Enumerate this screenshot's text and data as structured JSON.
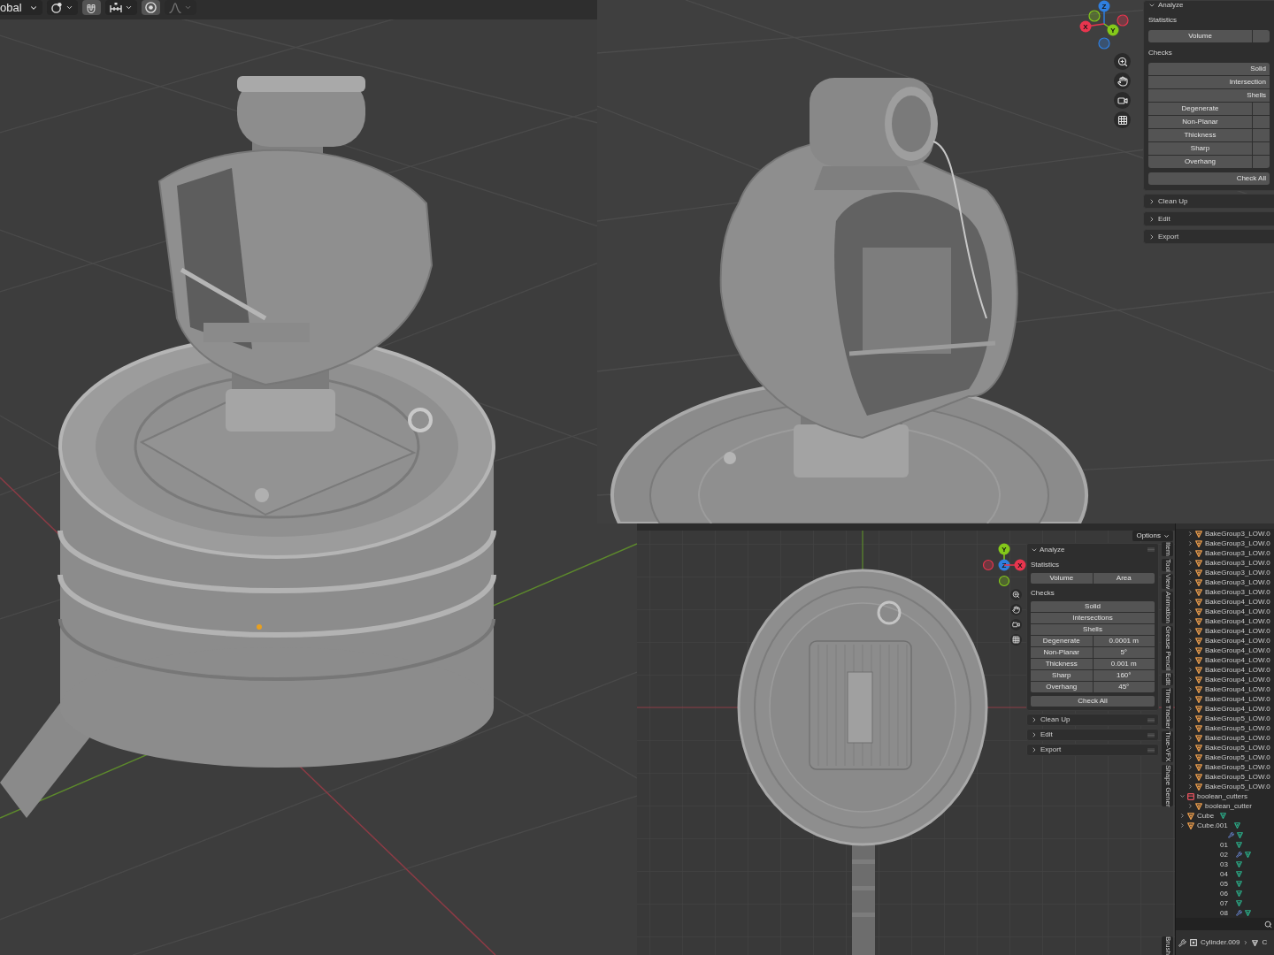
{
  "left_viewport": {
    "header": {
      "orientation": "obal",
      "tools": [
        {
          "kind": "pivot",
          "disabled": false
        },
        {
          "kind": "snap",
          "disabled": false
        },
        {
          "kind": "increment",
          "disabled": false
        },
        {
          "kind": "proportional",
          "disabled": false
        },
        {
          "kind": "falloff",
          "disabled": true
        }
      ]
    }
  },
  "top_right_viewport": {
    "gizmo": [
      {
        "label": "Z",
        "color": "#2f7fe0"
      },
      {
        "label": "X",
        "color": "#e8354e"
      },
      {
        "label": "Y",
        "color": "#84c91a"
      }
    ],
    "nav_buttons": [
      {
        "kind": "zoom"
      },
      {
        "kind": "pan"
      },
      {
        "kind": "camera"
      },
      {
        "kind": "perspective"
      }
    ],
    "panel": {
      "title": "Analyze",
      "expanded": true,
      "groups": [
        {
          "label": "Statistics",
          "rows": [
            {
              "kind": "pair",
              "left": "Volume"
            }
          ]
        },
        {
          "label": "Checks",
          "rows": [
            {
              "kind": "button",
              "text": "Solid"
            },
            {
              "kind": "button",
              "text": "Intersection"
            },
            {
              "kind": "button",
              "text": "Shells"
            },
            {
              "kind": "split",
              "left": "Degenerate"
            },
            {
              "kind": "split",
              "left": "Non-Planar"
            },
            {
              "kind": "split",
              "left": "Thickness"
            },
            {
              "kind": "split",
              "left": "Sharp"
            },
            {
              "kind": "split",
              "left": "Overhang"
            }
          ]
        }
      ],
      "check_all": "Check All",
      "subpanels": [
        {
          "title": "Clean Up",
          "expanded": false
        },
        {
          "title": "Edit",
          "expanded": false
        },
        {
          "title": "Export",
          "expanded": false
        }
      ]
    }
  },
  "bottom_right_viewport": {
    "options": "Options",
    "gizmo": [
      {
        "label": "Y",
        "color": "#84c91a"
      },
      {
        "label": "Z",
        "color": "#2f7fe0"
      },
      {
        "label": "X",
        "color": "#e8354e"
      }
    ],
    "nav_buttons": [
      {
        "kind": "zoom"
      },
      {
        "kind": "pan"
      },
      {
        "kind": "camera"
      },
      {
        "kind": "perspective"
      }
    ],
    "panel": {
      "title": "Analyze",
      "expanded": true,
      "groups": [
        {
          "label": "Statistics",
          "rows": [
            {
              "kind": "pair",
              "left": "Volume",
              "right": "Area"
            }
          ]
        },
        {
          "label": "Checks",
          "rows": [
            {
              "kind": "button",
              "text": "Solid"
            },
            {
              "kind": "button",
              "text": "Intersections"
            },
            {
              "kind": "button",
              "text": "Shells"
            },
            {
              "kind": "split",
              "left": "Degenerate",
              "right": "0.0001 m"
            },
            {
              "kind": "split",
              "left": "Non-Planar",
              "right": "5°"
            },
            {
              "kind": "split",
              "left": "Thickness",
              "right": "0.001 m"
            },
            {
              "kind": "split",
              "left": "Sharp",
              "right": "160°"
            },
            {
              "kind": "split",
              "left": "Overhang",
              "right": "45°"
            }
          ]
        }
      ],
      "check_all": "Check All",
      "subpanels": [
        {
          "title": "Clean Up",
          "expanded": false
        },
        {
          "title": "Edit",
          "expanded": false
        },
        {
          "title": "Export",
          "expanded": false
        }
      ]
    },
    "tabs": [
      "Item",
      "Tool",
      "View",
      "Animation",
      "Grease Pencil",
      "Edit",
      "Time Tracker",
      "True-VFX",
      "Shape Gener",
      "Brush"
    ],
    "outliner": {
      "continued_children": [
        {
          "kind": "object",
          "text": "BakeGroup3_LOW.0",
          "expanded": false
        },
        {
          "kind": "object",
          "text": "BakeGroup3_LOW.0",
          "expanded": false
        },
        {
          "kind": "object",
          "text": "BakeGroup3_LOW.0",
          "expanded": false
        },
        {
          "kind": "object",
          "text": "BakeGroup3_LOW.0",
          "expanded": false
        },
        {
          "kind": "object",
          "text": "BakeGroup3_LOW.0",
          "expanded": false
        },
        {
          "kind": "object",
          "text": "BakeGroup3_LOW.0",
          "expanded": false
        },
        {
          "kind": "object",
          "text": "BakeGroup3_LOW.0",
          "expanded": false
        },
        {
          "kind": "object",
          "text": "BakeGroup4_LOW.0",
          "expanded": false
        },
        {
          "kind": "object",
          "text": "BakeGroup4_LOW.0",
          "expanded": false
        },
        {
          "kind": "object",
          "text": "BakeGroup4_LOW.0",
          "expanded": false
        },
        {
          "kind": "object",
          "text": "BakeGroup4_LOW.0",
          "expanded": false
        },
        {
          "kind": "object",
          "text": "BakeGroup4_LOW.0",
          "expanded": false
        },
        {
          "kind": "object",
          "text": "BakeGroup4_LOW.0",
          "expanded": false
        },
        {
          "kind": "object",
          "text": "BakeGroup4_LOW.0",
          "expanded": false
        },
        {
          "kind": "object",
          "text": "BakeGroup4_LOW.0",
          "expanded": false
        },
        {
          "kind": "object",
          "text": "BakeGroup4_LOW.0",
          "expanded": false
        },
        {
          "kind": "object",
          "text": "BakeGroup4_LOW.0",
          "expanded": false
        },
        {
          "kind": "object",
          "text": "BakeGroup4_LOW.0",
          "expanded": false
        },
        {
          "kind": "object",
          "text": "BakeGroup4_LOW.0",
          "expanded": false
        },
        {
          "kind": "object",
          "text": "BakeGroup5_LOW.0",
          "expanded": false
        },
        {
          "kind": "object",
          "text": "BakeGroup5_LOW.0",
          "expanded": false
        },
        {
          "kind": "object",
          "text": "BakeGroup5_LOW.0",
          "expanded": false
        },
        {
          "kind": "object",
          "text": "BakeGroup5_LOW.0",
          "expanded": false
        },
        {
          "kind": "object",
          "text": "BakeGroup5_LOW.0",
          "expanded": false
        },
        {
          "kind": "object",
          "text": "BakeGroup5_LOW.0",
          "expanded": false
        },
        {
          "kind": "object",
          "text": "BakeGroup5_LOW.0",
          "expanded": false
        },
        {
          "kind": "object",
          "text": "BakeGroup5_LOW.0",
          "expanded": false
        }
      ],
      "rows": [
        {
          "kind": "collection",
          "text": "boolean_cutters",
          "expanded": true,
          "children": [
            {
              "kind": "object",
              "text": "boolean_cutter",
              "expanded": false,
              "mesh_data": false
            }
          ]
        },
        {
          "kind": "object",
          "text": "Cube",
          "expanded": false,
          "mesh_data": true
        },
        {
          "kind": "object",
          "text": "Cube.001",
          "expanded": false,
          "mesh_data": true
        }
      ],
      "partial_rows": [
        {
          "modifiers": true,
          "mesh_data": true
        },
        {
          "text": "01",
          "modifiers": false,
          "mesh_data": true
        },
        {
          "text": "02",
          "modifiers": true,
          "mesh_data": true
        },
        {
          "text": "03",
          "modifiers": false,
          "mesh_data": true
        },
        {
          "text": "04",
          "modifiers": false,
          "mesh_data": true
        },
        {
          "text": "05",
          "modifiers": false,
          "mesh_data": true
        },
        {
          "text": "06",
          "modifiers": false,
          "mesh_data": true
        },
        {
          "text": "07",
          "modifiers": false,
          "mesh_data": true
        },
        {
          "text": "08",
          "modifiers": true,
          "mesh_data": true
        }
      ]
    },
    "properties_header": {
      "object": "Cylinder.009",
      "data": "C"
    }
  }
}
